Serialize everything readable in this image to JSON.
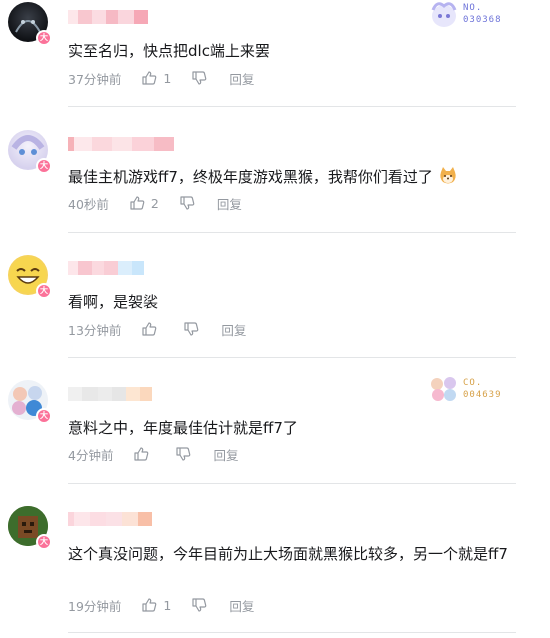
{
  "comments": [
    {
      "content": "实至名归，快点把dlc端上来罢",
      "time": "37分钟前",
      "likes": "1",
      "reply_label": "回复",
      "badge": {
        "line1": "NO.",
        "line2": "030368",
        "color": "#6e74d9"
      }
    },
    {
      "content": "最佳主机游戏ff7，终极年度游戏黑猴，我帮你们看过了",
      "time": "40秒前",
      "likes": "2",
      "reply_label": "回复"
    },
    {
      "content": "看啊，是袈裟",
      "time": "13分钟前",
      "likes": "",
      "reply_label": "回复"
    },
    {
      "content": "意料之中，年度最佳估计就是ff7了",
      "time": "4分钟前",
      "likes": "",
      "reply_label": "回复",
      "badge": {
        "line1": "CO.",
        "line2": "004639",
        "color": "#d7a24a"
      }
    },
    {
      "content": "这个真没问题，今年目前为止大场面就黑猴比较多，另一个就是ff7",
      "time": "19分钟前",
      "likes": "1",
      "reply_label": "回复"
    }
  ],
  "colors": {
    "level_badge": "#fb7299",
    "meta_text": "#9499a0",
    "divider": "#e3e5e7"
  },
  "icons": {
    "like": "thumb-up-icon",
    "dislike": "thumb-down-icon",
    "emoji": "shiba-emoji-icon"
  }
}
